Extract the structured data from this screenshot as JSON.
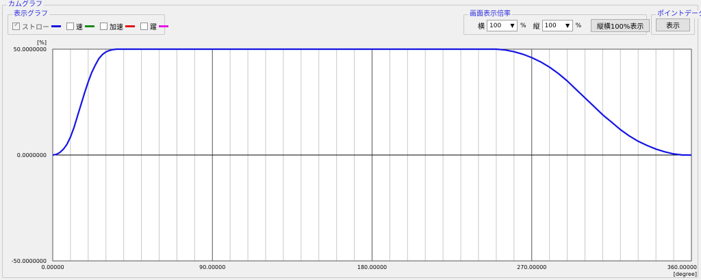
{
  "window": {
    "title": "カムグラフ"
  },
  "display_group": {
    "title": "表示グラフ",
    "items": [
      {
        "label": "ストロー",
        "checked": true,
        "color": "#1414e6"
      },
      {
        "label": "速",
        "checked": false,
        "color": "#1a8a1a"
      },
      {
        "label": "加速",
        "checked": false,
        "color": "#e61414"
      },
      {
        "label": "躍",
        "checked": false,
        "color": "#e614e6"
      }
    ]
  },
  "scale_group": {
    "title": "画面表示倍率",
    "horizontal_label": "横",
    "horizontal_value": "100",
    "vertical_label": "縦",
    "vertical_value": "100",
    "unit": "%",
    "reset_button": "縦横100%表示"
  },
  "point_group": {
    "title": "ポイントデータ",
    "show_button": "表示"
  },
  "chart_data": {
    "type": "line",
    "ylabel": "[%]",
    "xlabel": "[degree]",
    "xlim": [
      0,
      360
    ],
    "ylim": [
      -50,
      50
    ],
    "x_ticks": [
      "0.00000",
      "90.00000",
      "180.00000",
      "270.00000",
      "360.00000"
    ],
    "y_ticks": [
      "50.0000000",
      "0.0000000",
      "-50.0000000"
    ],
    "minor_grid_step": 10,
    "grid": true,
    "series": [
      {
        "color": "#1414e6",
        "points": [
          [
            0,
            0
          ],
          [
            2,
            0.3
          ],
          [
            4,
            1.2
          ],
          [
            6,
            2.7
          ],
          [
            8,
            5
          ],
          [
            10,
            8.5
          ],
          [
            12,
            13
          ],
          [
            14,
            18.5
          ],
          [
            16,
            24
          ],
          [
            18,
            29.5
          ],
          [
            20,
            34.5
          ],
          [
            22,
            39
          ],
          [
            24,
            42.5
          ],
          [
            26,
            45.5
          ],
          [
            28,
            47.5
          ],
          [
            30,
            48.7
          ],
          [
            32,
            49.4
          ],
          [
            34,
            49.8
          ],
          [
            36,
            50
          ],
          [
            250,
            50
          ],
          [
            255,
            49.6
          ],
          [
            260,
            48.8
          ],
          [
            265,
            47.6
          ],
          [
            270,
            46
          ],
          [
            275,
            44
          ],
          [
            280,
            41.5
          ],
          [
            285,
            38.5
          ],
          [
            290,
            35
          ],
          [
            295,
            31
          ],
          [
            300,
            27
          ],
          [
            305,
            23
          ],
          [
            310,
            19
          ],
          [
            315,
            15.5
          ],
          [
            320,
            12
          ],
          [
            325,
            9
          ],
          [
            330,
            6.5
          ],
          [
            335,
            4.5
          ],
          [
            340,
            2.8
          ],
          [
            345,
            1.5
          ],
          [
            350,
            0.5
          ],
          [
            355,
            0
          ],
          [
            360,
            0
          ]
        ]
      }
    ]
  }
}
